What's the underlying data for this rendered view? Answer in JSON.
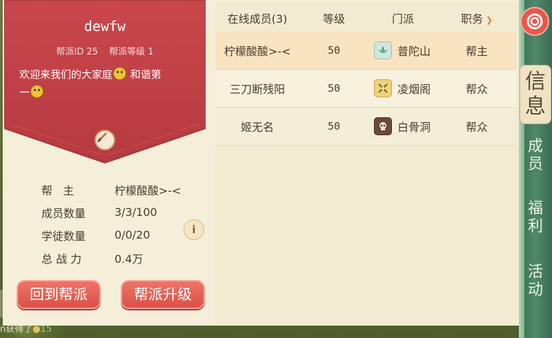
{
  "guild": {
    "name": "dewfw",
    "id_label": "帮派ID 25",
    "level_label": "帮派等级 1",
    "motto_part1": "欢迎来我们的大家庭",
    "motto_part2": " 和谐第",
    "motto_part3": "一"
  },
  "info": {
    "leader_key": "帮   主",
    "leader_val": "柠檬酸酸>-<",
    "members_key": "成员数量",
    "members_val": "3/3/100",
    "apprentices_key": "学徒数量",
    "apprentices_val": "0/0/20",
    "power_key": "总 战 力",
    "power_val": "0.4万"
  },
  "buttons": {
    "back": "回到帮派",
    "upgrade": "帮派升级"
  },
  "table": {
    "headers": {
      "name": "在线成员(3)",
      "level": "等级",
      "sect": "门派",
      "role": "职务"
    },
    "rows": [
      {
        "name": "柠檬酸酸>-<",
        "level": "50",
        "sect": "普陀山",
        "role": "帮主",
        "icon": "lotus-icon"
      },
      {
        "name": "三刀断残阳",
        "level": "50",
        "sect": "凌烟阁",
        "role": "帮众",
        "icon": "crossed-swords-icon"
      },
      {
        "name": "姬无名",
        "level": "50",
        "sect": "白骨洞",
        "role": "帮众",
        "icon": "skull-icon"
      }
    ]
  },
  "tabs": {
    "info": "信息",
    "members": "成员",
    "welfare": "福利",
    "activity": "活动"
  },
  "world_chat": {
    "text": "n获得了",
    "amount": "15"
  },
  "colors": {
    "banner": "#c4464a",
    "button": "#e1564b",
    "sidebar": "#4f8a6a",
    "panel": "#f5efd9"
  }
}
